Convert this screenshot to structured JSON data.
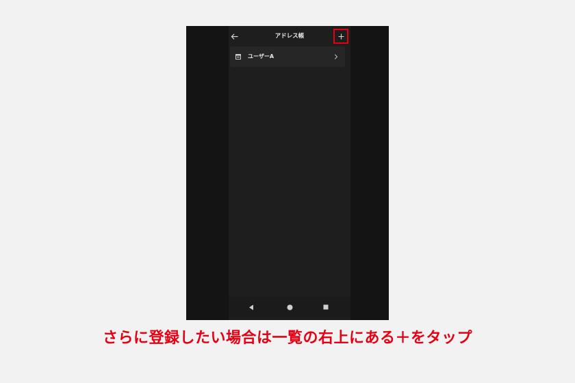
{
  "header": {
    "title": "アドレス帳",
    "back_icon": "arrow-left-icon",
    "add_icon": "plus-icon",
    "highlight_color": "#e60012"
  },
  "list": {
    "items": [
      {
        "label": "ユーザーA",
        "icon": "address-card-icon",
        "chevron": "chevron-right-icon"
      }
    ]
  },
  "system_nav": {
    "back_icon": "triangle-back-icon",
    "home_icon": "circle-home-icon",
    "recents_icon": "square-recents-icon"
  },
  "caption": {
    "text": "さらに登録したい場合は一覧の右上にある＋をタップ",
    "color": "#e60012"
  }
}
